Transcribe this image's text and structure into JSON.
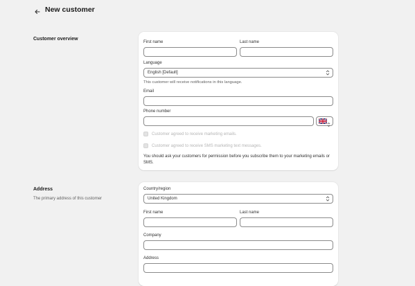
{
  "page": {
    "title": "New customer"
  },
  "overview": {
    "title": "Customer overview",
    "first_name_label": "First name",
    "last_name_label": "Last name",
    "language_label": "Language",
    "language_value": "English [Default]",
    "language_help": "This customer will receive notifications in this language.",
    "email_label": "Email",
    "phone_label": "Phone number",
    "phone_country_flag": "uk-flag",
    "marketing_email_label": "Customer agreed to receive marketing emails.",
    "marketing_sms_label": "Customer agreed to receive SMS marketing text messages.",
    "permission_note": "You should ask your customers for permission before you subscribe them to your marketing emails or SMS."
  },
  "address": {
    "title": "Address",
    "description": "The primary address of this customer",
    "country_label": "Country/region",
    "country_value": "United Kingdom",
    "first_name_label": "First name",
    "last_name_label": "Last name",
    "company_label": "Company",
    "address_label": "Address"
  },
  "colors": {
    "background": "#f1f1f1",
    "card": "#ffffff",
    "border": "#8a8a8a"
  }
}
